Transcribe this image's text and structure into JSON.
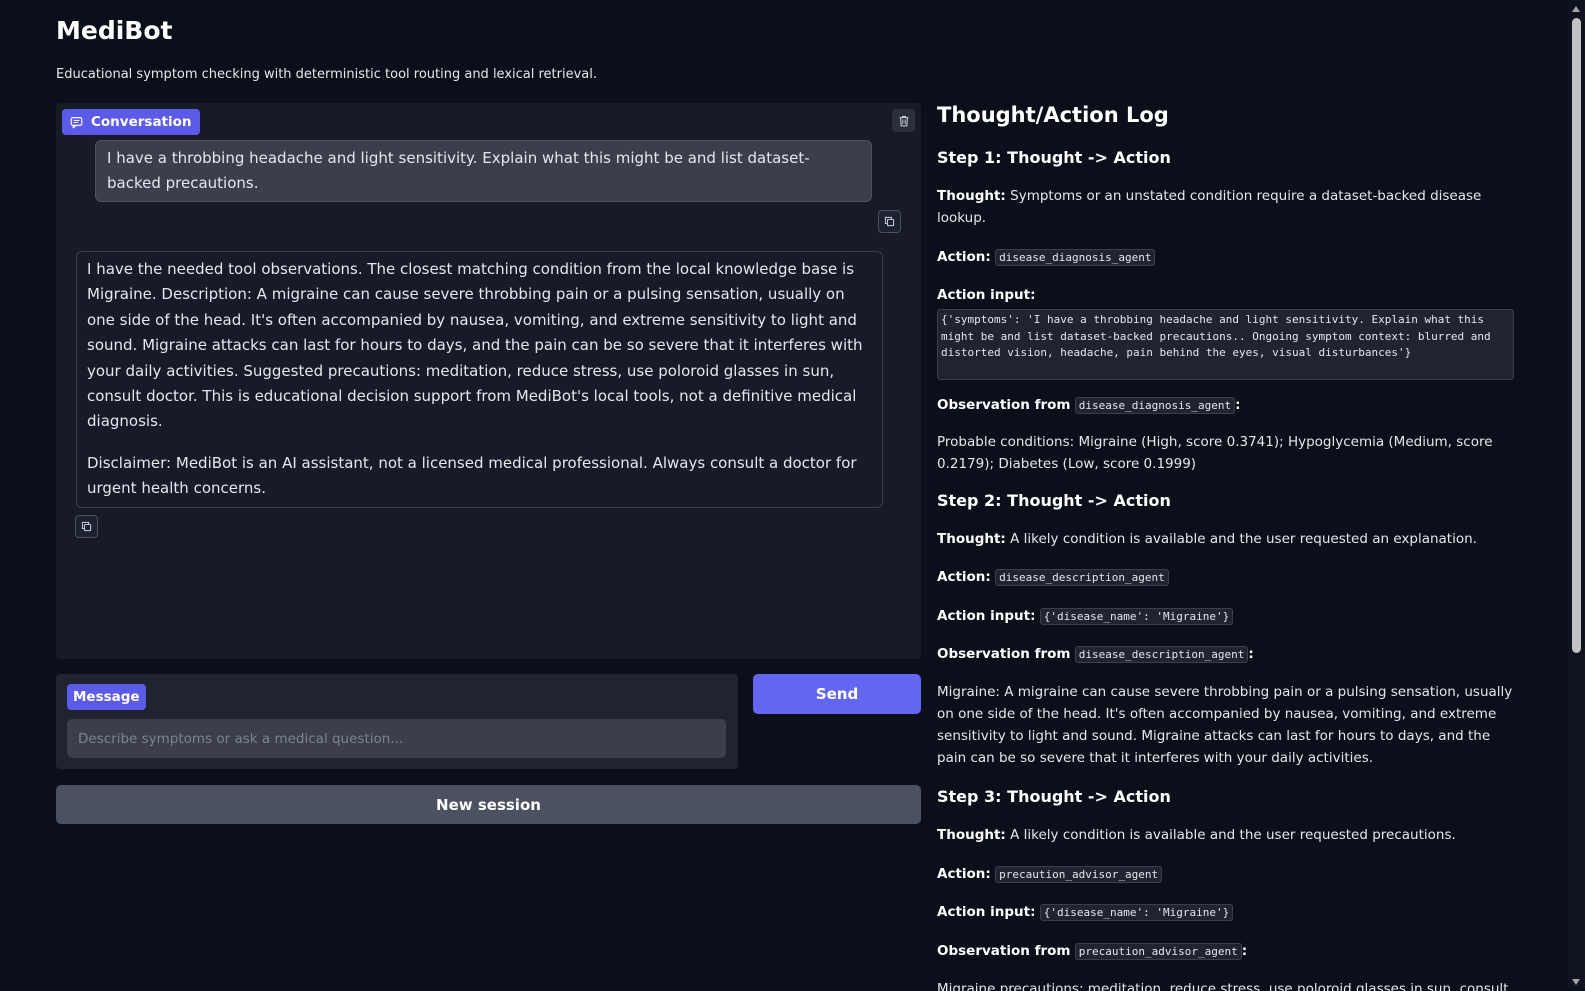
{
  "app": {
    "title": "MediBot",
    "subtitle": "Educational symptom checking with deterministic tool routing and lexical retrieval."
  },
  "chat": {
    "label": "Conversation",
    "user_message": "I have a throbbing headache and light sensitivity. Explain what this might be and list dataset-backed precautions.",
    "bot_message": [
      "I have the needed tool observations. The closest matching condition from the local knowledge base is Migraine. Description: A migraine can cause severe throbbing pain or a pulsing sensation, usually on one side of the head. It's often accompanied by nausea, vomiting, and extreme sensitivity to light and sound. Migraine attacks can last for hours to days, and the pain can be so severe that it interferes with your daily activities. Suggested precautions: meditation, reduce stress, use poloroid glasses in sun, consult doctor. This is educational decision support from MediBot's local tools, not a definitive medical diagnosis.",
      "Disclaimer: MediBot is an AI assistant, not a licensed medical professional. Always consult a doctor for urgent health concerns."
    ]
  },
  "input": {
    "label": "Message",
    "placeholder": "Describe symptoms or ask a medical question...",
    "value": ""
  },
  "buttons": {
    "send": "Send",
    "new_session": "New session"
  },
  "log": {
    "title": "Thought/Action Log",
    "labels": {
      "thought": "Thought:",
      "action": "Action:",
      "action_input": "Action input:",
      "observation_from": "Observation from",
      "colon": ":"
    },
    "steps": [
      {
        "heading": "Step 1: Thought -> Action",
        "thought": "Symptoms or an unstated condition require a dataset-backed disease lookup.",
        "action": "disease_diagnosis_agent",
        "action_input": "{'symptoms': 'I have a throbbing headache and light sensitivity. Explain what this might be and list dataset-backed precautions.. Ongoing symptom context: blurred and distorted vision, headache, pain behind the eyes, visual disturbances'}",
        "observation_agent": "disease_diagnosis_agent",
        "observation": "Probable conditions: Migraine (High, score 0.3741); Hypoglycemia (Medium, score 0.2179); Diabetes (Low, score 0.1999)"
      },
      {
        "heading": "Step 2: Thought -> Action",
        "thought": "A likely condition is available and the user requested an explanation.",
        "action": "disease_description_agent",
        "action_input": "{'disease_name': 'Migraine'}",
        "observation_agent": "disease_description_agent",
        "observation": "Migraine: A migraine can cause severe throbbing pain or a pulsing sensation, usually on one side of the head. It's often accompanied by nausea, vomiting, and extreme sensitivity to light and sound. Migraine attacks can last for hours to days, and the pain can be so severe that it interferes with your daily activities."
      },
      {
        "heading": "Step 3: Thought -> Action",
        "thought": "A likely condition is available and the user requested precautions.",
        "action": "precaution_advisor_agent",
        "action_input": "{'disease_name': 'Migraine'}",
        "observation_agent": "precaution_advisor_agent",
        "observation": "Migraine precautions: meditation, reduce stress, use poloroid glasses in sun, consult doctor"
      }
    ]
  },
  "icons": {
    "conversation": "chat-bubble-icon",
    "clear": "trash-icon",
    "copy": "copy-icon"
  },
  "colors": {
    "background": "#0b0f19",
    "accent": "#6366f1",
    "badge": "#5b5be8",
    "panel": "#161b27"
  }
}
